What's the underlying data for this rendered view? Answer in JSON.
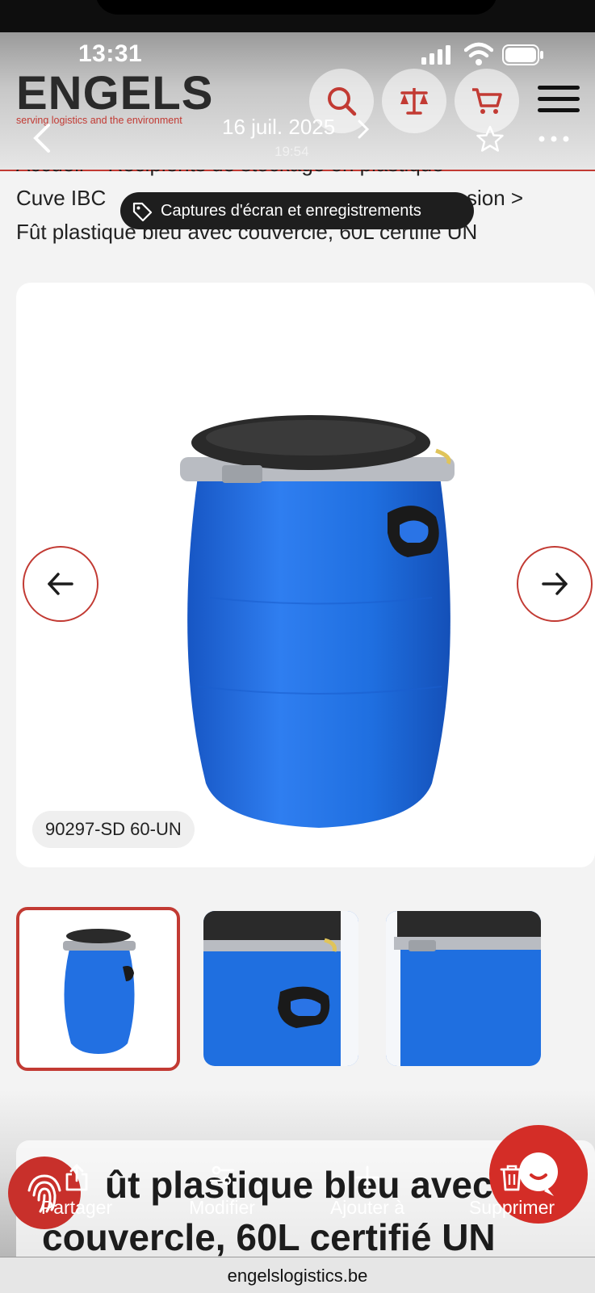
{
  "status_bar": {
    "time": "13:31"
  },
  "header": {
    "logo_text": "ENGELS",
    "logo_tagline": "serving logistics and the environment",
    "brand_color": "#c23a33"
  },
  "photo_viewer": {
    "date": "16 juil. 2025",
    "time": "19:54"
  },
  "breadcrumb": {
    "line1": "Accueil  >  Récipients de stockage en plastique  >",
    "line2_start": "Cuve IBC",
    "line2_end": "sion  >",
    "line3": "Fût plastique bleu avec couvercle, 60L certifié UN"
  },
  "toast": {
    "label": "Captures d'écran et enregistrements"
  },
  "product": {
    "sku": "90297-SD 60-UN",
    "title_line1": "ût plastique bleu avec",
    "title_line2": "couvercle, 60L certifié UN",
    "barrel_color": "#1f6fe0"
  },
  "actions": {
    "share": "Partager",
    "edit": "Modifier",
    "add": "Ajouter à",
    "delete": "Supprimer"
  },
  "browser": {
    "url": "engelslogistics.be"
  }
}
